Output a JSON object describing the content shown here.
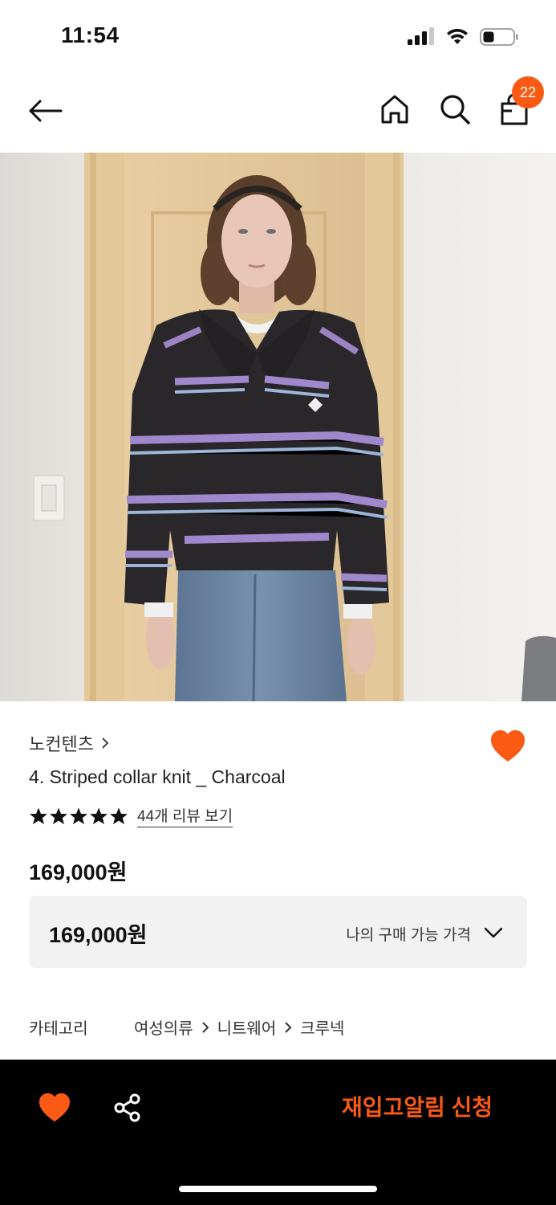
{
  "status_bar": {
    "time": "11:54"
  },
  "nav": {
    "cart_count": "22"
  },
  "product": {
    "brand": "노컨텐츠",
    "name": "4. Striped collar knit _ Charcoal",
    "rating_stars": 5,
    "review_link": "44개 리뷰 보기",
    "price": "169,000원"
  },
  "price_box": {
    "value": "169,000원",
    "label": "나의 구매 가능 가격"
  },
  "category": {
    "label": "카테고리",
    "path": [
      "여성의류",
      "니트웨어",
      "크루넥"
    ]
  },
  "bottom_bar": {
    "restock_label": "재입고알림 신청"
  },
  "colors": {
    "accent": "#fa5a14",
    "price_box_bg": "#f2f2f2",
    "bottom_bar_bg": "#000000"
  }
}
